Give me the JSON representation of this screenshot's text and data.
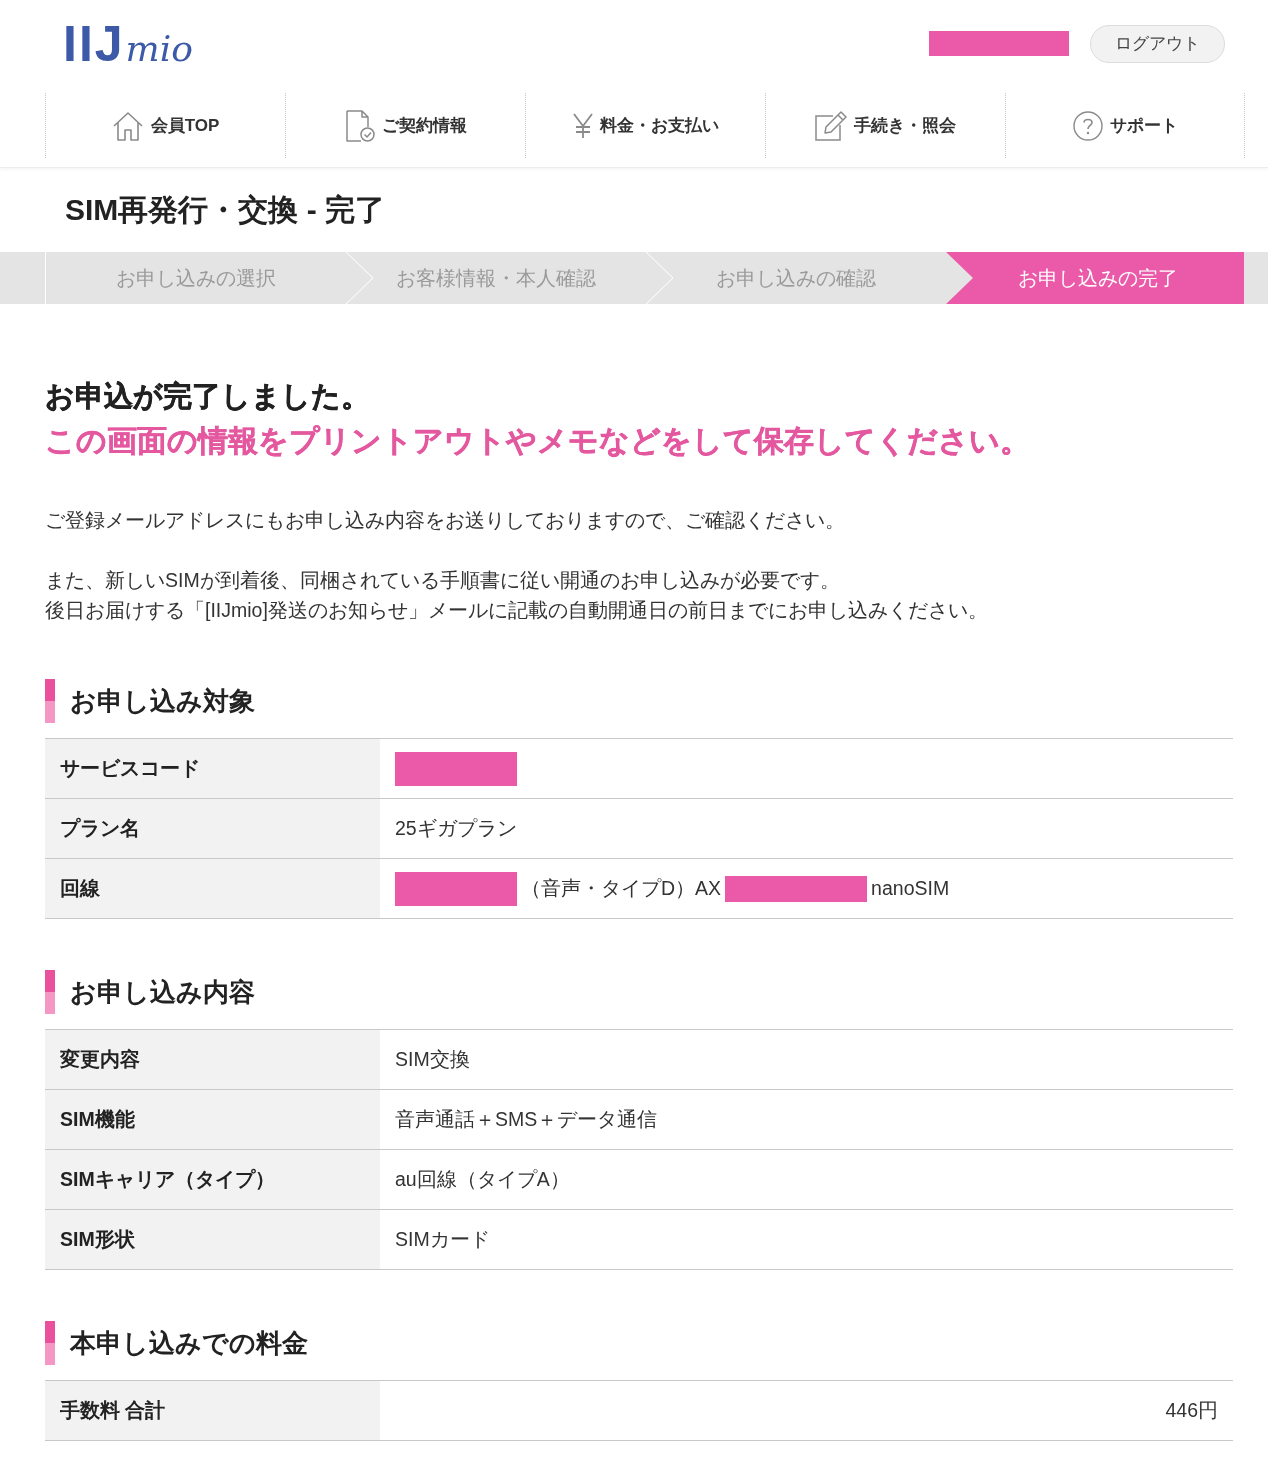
{
  "header": {
    "logo": {
      "wordmark": "IIJ",
      "script": "mio"
    },
    "user_name_redacted": true,
    "logout_button": "ログアウト"
  },
  "nav": [
    {
      "label": "会員TOP"
    },
    {
      "label": "ご契約情報"
    },
    {
      "label": "料金・お支払い"
    },
    {
      "label": "手続き・照会"
    },
    {
      "label": "サポート"
    }
  ],
  "page_title": "SIM再発行・交換 - 完了",
  "steps": [
    {
      "label": "お申し込みの選択",
      "selected": false
    },
    {
      "label": "お客様情報・本人確認",
      "selected": false
    },
    {
      "label": "お申し込みの確認",
      "selected": false
    },
    {
      "label": "お申し込みの完了",
      "selected": true
    }
  ],
  "completion": {
    "heading": "お申込が完了しました。",
    "notice": "この画面の情報をプリントアウトやメモなどをして保存してください。"
  },
  "notes": [
    [
      "ご登録メールアドレスにもお申し込み内容をお送りしておりますので、ご確認ください。"
    ],
    [
      "また、新しいSIMが到着後、同梱されている手順書に従い開通のお申し込みが必要です。",
      "後日お届けする「[IIJmio]発送のお知らせ」メールに記載の自動開通日の前日までにお申し込みください。"
    ]
  ],
  "sections": [
    {
      "title": "お申し込み対象",
      "rows": [
        {
          "kind": "detail",
          "label": "サービスコード",
          "value": [
            {
              "kind": "redaction"
            }
          ]
        },
        {
          "kind": "detail",
          "label": "プラン名",
          "value": [
            {
              "kind": "text",
              "text": "25ギガプラン"
            }
          ]
        },
        {
          "kind": "detail",
          "label": "回線",
          "value": [
            {
              "kind": "redaction"
            },
            {
              "kind": "text",
              "text": "（音声・タイプD）AX"
            },
            {
              "kind": "redaction"
            },
            {
              "kind": "text",
              "text": "nanoSIM"
            }
          ]
        }
      ]
    },
    {
      "title": "お申し込み内容",
      "rows": [
        {
          "kind": "detail",
          "label": "変更内容",
          "value": [
            {
              "kind": "text",
              "text": "SIM交換"
            }
          ]
        },
        {
          "kind": "detail",
          "label": "SIM機能",
          "value": [
            {
              "kind": "text",
              "text": "音声通話＋SMS＋データ通信"
            }
          ]
        },
        {
          "kind": "detail",
          "label": "SIMキャリア（タイプ）",
          "value": [
            {
              "kind": "text",
              "text": "au回線（タイプA）"
            }
          ]
        },
        {
          "kind": "detail",
          "label": "SIM形状",
          "value": [
            {
              "kind": "text",
              "text": "SIMカード"
            }
          ]
        }
      ]
    },
    {
      "title": "本申し込みでの料金",
      "rows": [
        {
          "kind": "amount",
          "label": "手数料 合計",
          "value": [
            {
              "kind": "text",
              "text": "446円"
            }
          ]
        }
      ]
    }
  ]
}
